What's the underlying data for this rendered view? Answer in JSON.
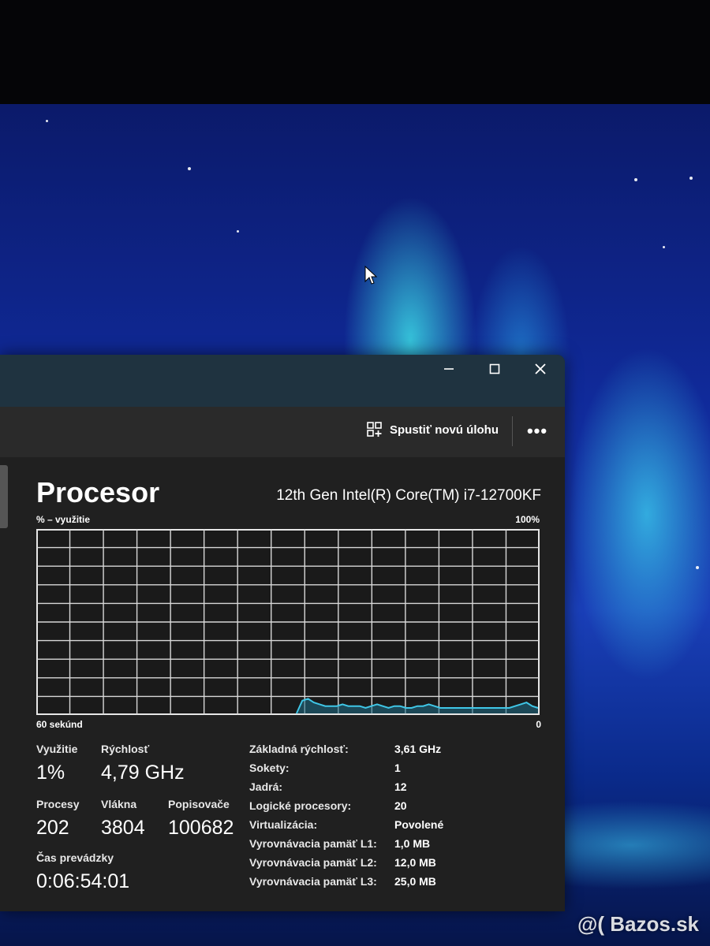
{
  "window": {
    "title_buttons": {
      "minimize": "minimize-icon",
      "maximize": "maximize-icon",
      "close": "close-icon"
    },
    "toolbar": {
      "new_task_label": "Spustiť novú úlohu",
      "more_label": "•••"
    }
  },
  "cpu": {
    "title": "Procesor",
    "name": "12th Gen Intel(R) Core(TM) i7-12700KF",
    "graph": {
      "label_left": "% – využitie",
      "label_right": "100%",
      "footer_left": "60 sekúnd",
      "footer_right": "0",
      "line_color": "#3fc6e6",
      "fill_color": "#1f6f8a",
      "usage_history": [
        0,
        0,
        0,
        0,
        0,
        0,
        0,
        0,
        0,
        0,
        0,
        0,
        0,
        0,
        0,
        0,
        0,
        0,
        0,
        0,
        0,
        0,
        0,
        0,
        0,
        0,
        0,
        0,
        0,
        0,
        0,
        0,
        0,
        0,
        0,
        0,
        0,
        0,
        0,
        0,
        0,
        0,
        0,
        0,
        0,
        0,
        7,
        8,
        6,
        5,
        4,
        4,
        4,
        5,
        4,
        4,
        4,
        3,
        4,
        5,
        4,
        3,
        4,
        4,
        3,
        3,
        4,
        4,
        5,
        4,
        3,
        3,
        3,
        3,
        3,
        3,
        3,
        3,
        3,
        3,
        3,
        3,
        3,
        4,
        5,
        6,
        4,
        3
      ]
    },
    "stats": {
      "usage_label": "Využitie",
      "usage_value": "1%",
      "speed_label": "Rýchlosť",
      "speed_value": "4,79 GHz",
      "processes_label": "Procesy",
      "processes_value": "202",
      "threads_label": "Vlákna",
      "threads_value": "3804",
      "handles_label": "Popisovače",
      "handles_value": "100682",
      "uptime_label": "Čas prevádzky",
      "uptime_value": "0:06:54:01"
    },
    "specs": [
      {
        "key": "Základná rýchlosť:",
        "value": "3,61 GHz"
      },
      {
        "key": "Sokety:",
        "value": "1"
      },
      {
        "key": "Jadrá:",
        "value": "12"
      },
      {
        "key": "Logické procesory:",
        "value": "20"
      },
      {
        "key": "Virtualizácia:",
        "value": "Povolené"
      },
      {
        "key": "Vyrovnávacia pamäť L1:",
        "value": "1,0 MB"
      },
      {
        "key": "Vyrovnávacia pamäť L2:",
        "value": "12,0 MB"
      },
      {
        "key": "Vyrovnávacia pamäť L3:",
        "value": "25,0 MB"
      }
    ]
  },
  "watermark": "@( Bazos.sk"
}
